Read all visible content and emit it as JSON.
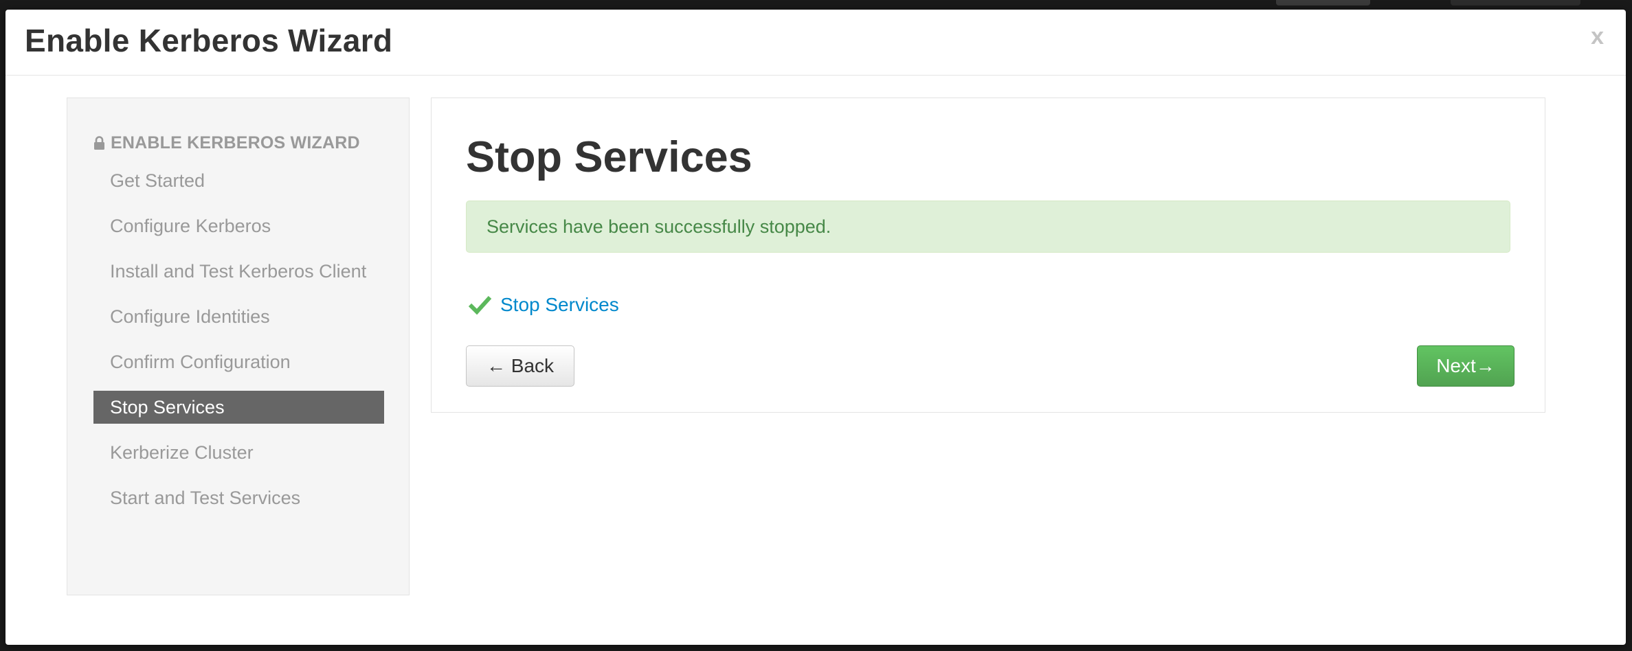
{
  "modal": {
    "title": "Enable Kerberos Wizard",
    "close_label": "x"
  },
  "sidebar": {
    "header": "ENABLE KERBEROS WIZARD",
    "header_icon": "lock-icon",
    "steps": [
      {
        "label": "Get Started",
        "active": false
      },
      {
        "label": "Configure Kerberos",
        "active": false
      },
      {
        "label": "Install and Test Kerberos Client",
        "active": false
      },
      {
        "label": "Configure Identities",
        "active": false
      },
      {
        "label": "Confirm Configuration",
        "active": false
      },
      {
        "label": "Stop Services",
        "active": true
      },
      {
        "label": "Kerberize Cluster",
        "active": false
      },
      {
        "label": "Start and Test Services",
        "active": false
      }
    ]
  },
  "content": {
    "title": "Stop Services",
    "alert": "Services have been successfully stopped.",
    "task": {
      "icon": "check-icon",
      "label": "Stop Services",
      "status": "completed"
    },
    "back_label": "← Back",
    "next_label": "Next→"
  },
  "colors": {
    "success_green": "#5cb85c",
    "alert_bg": "#dff0d8",
    "alert_text": "#468847",
    "link_blue": "#0088cc",
    "active_step_bg": "#666666"
  }
}
